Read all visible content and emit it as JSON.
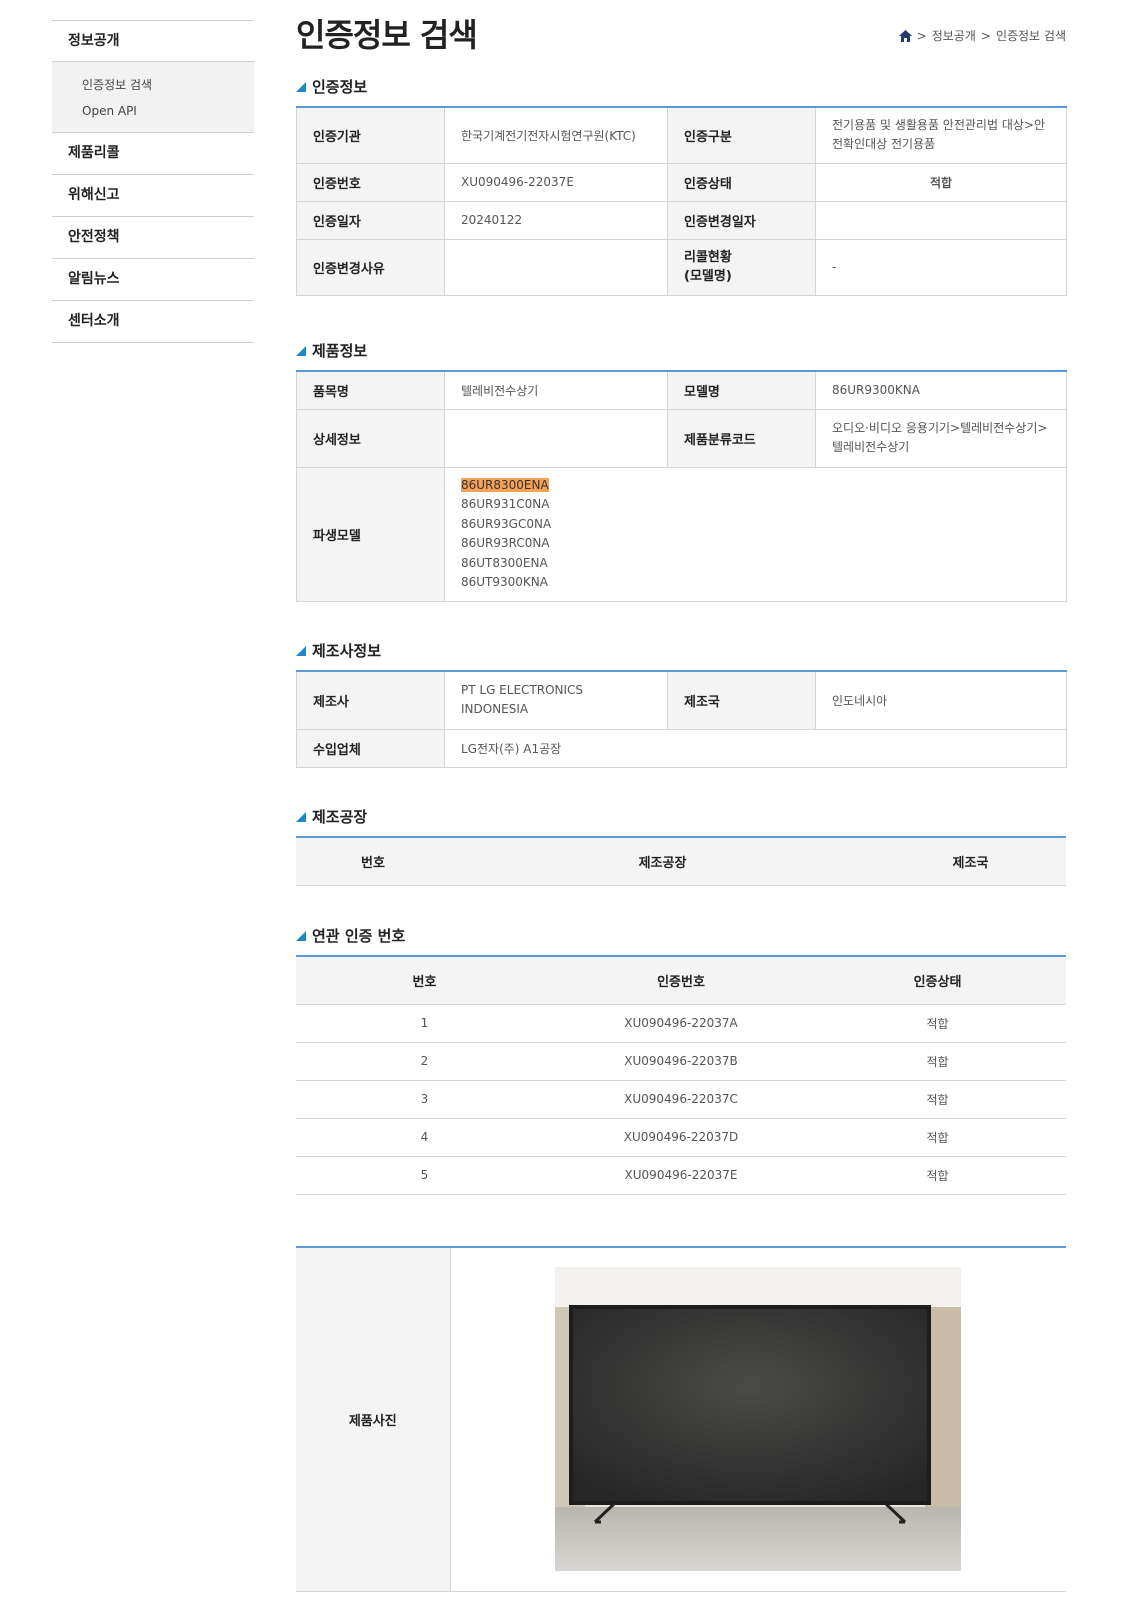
{
  "sidebar": {
    "head": "정보공개",
    "sub": [
      "인증정보 검색",
      "Open API"
    ],
    "items": [
      "제품리콜",
      "위해신고",
      "안전정책",
      "알림뉴스",
      "센터소개"
    ]
  },
  "page": {
    "title": "인증정보 검색",
    "breadcrumb": [
      "정보공개",
      "인증정보 검색"
    ],
    "separator": ">"
  },
  "cert": {
    "title": "인증정보",
    "agency_label": "인증기관",
    "agency": "한국기계전기전자시험연구원(KTC)",
    "type_label": "인증구분",
    "type": "전기용품 및 생활용품 안전관리법 대상>안전확인대상 전기용품",
    "number_label": "인증번호",
    "number": "XU090496-22037E",
    "status_label": "인증상태",
    "status": "적합",
    "date_label": "인증일자",
    "date": "20240122",
    "change_date_label": "인증변경일자",
    "change_date": "",
    "change_reason_label": "인증변경사유",
    "change_reason": "",
    "recall_label_1": "리콜현황",
    "recall_label_2": "(모델명)",
    "recall": "-"
  },
  "product": {
    "title": "제품정보",
    "item_label": "품목명",
    "item": "텔레비전수상기",
    "model_label": "모델명",
    "model": "86UR9300KNA",
    "detail_label": "상세정보",
    "detail": "",
    "code_label": "제품분류코드",
    "code": "오디오·비디오 응용기기>텔레비전수상기>텔레비전수상기",
    "derived_label": "파생모델",
    "derived": [
      "86UR8300ENA",
      "86UR931C0NA",
      "86UR93GC0NA",
      "86UR93RC0NA",
      "86UT8300ENA",
      "86UT9300KNA"
    ]
  },
  "maker": {
    "title": "제조사정보",
    "maker_label": "제조사",
    "maker": "PT LG ELECTRONICS INDONESIA",
    "country_label": "제조국",
    "country": "인도네시아",
    "importer_label": "수입업체",
    "importer": "LG전자(주) A1공장"
  },
  "factory": {
    "title": "제조공장",
    "headers": [
      "번호",
      "제조공장",
      "제조국"
    ]
  },
  "related": {
    "title": "연관 인증 번호",
    "headers": [
      "번호",
      "인증번호",
      "인증상태"
    ],
    "rows": [
      {
        "no": "1",
        "cert": "XU090496-22037A",
        "status": "적합"
      },
      {
        "no": "2",
        "cert": "XU090496-22037B",
        "status": "적합"
      },
      {
        "no": "3",
        "cert": "XU090496-22037C",
        "status": "적합"
      },
      {
        "no": "4",
        "cert": "XU090496-22037D",
        "status": "적합"
      },
      {
        "no": "5",
        "cert": "XU090496-22037E",
        "status": "적합"
      }
    ]
  },
  "photo": {
    "label": "제품사진"
  },
  "colors": {
    "accent": "#5b9bd5",
    "ok_status": "#1f3a93",
    "highlight": "#f6a256"
  },
  "icons": {
    "home": "home-icon",
    "section": "triangle-marker-icon"
  }
}
